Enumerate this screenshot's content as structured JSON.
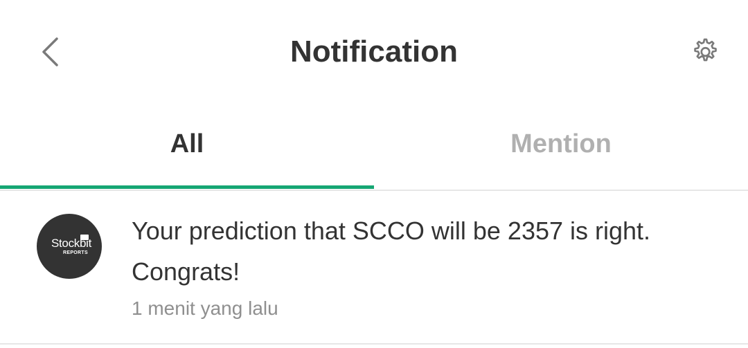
{
  "header": {
    "title": "Notification",
    "back_icon": "chevron-left-icon",
    "settings_icon": "gear-icon"
  },
  "tabs": [
    {
      "label": "All",
      "active": true
    },
    {
      "label": "Mention",
      "active": false
    }
  ],
  "colors": {
    "accent": "#16a673",
    "text_primary": "#333333",
    "text_inactive": "#b0b0b0",
    "text_muted": "#8f8f8f",
    "avatar_bg": "#333333"
  },
  "notifications": [
    {
      "avatar": {
        "brand": "Stockbit",
        "sub": "REPORTS"
      },
      "message": "Your prediction that SCCO will be 2357 is right. Congrats!",
      "time": "1 menit yang lalu"
    }
  ]
}
